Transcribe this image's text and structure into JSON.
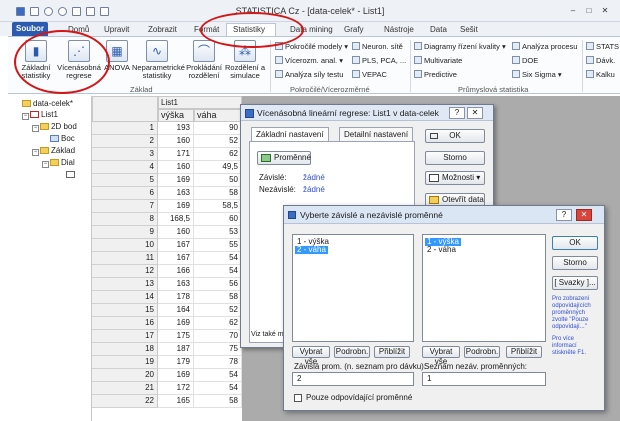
{
  "window": {
    "title": "STATISTICA Cz - [data-celek* - List1]",
    "controls": [
      "–",
      "□",
      "✕"
    ]
  },
  "ribbon": {
    "tabs": [
      "Soubor",
      "Domů",
      "Upravit",
      "Zobrazit",
      "Formát",
      "Statistiky",
      "Data mining",
      "Grafy",
      "Nástroje",
      "Data",
      "Sešit"
    ],
    "active_tab": "Statistiky",
    "big_buttons": [
      "Základní statistiky",
      "Vícenásobná regrese",
      "ANOVA",
      "Neparametrické statistiky",
      "Prokládání rozdělení",
      "Rozdělení a simulace"
    ],
    "small_buttons": [
      "Pokročilé modely",
      "Vícerozm. anal.",
      "Analýza síly testu",
      "Neuron. sítě",
      "PLS, PCA, ...",
      "VEPAC",
      "Diagramy řízení kvality",
      "Multivariate",
      "Predictive",
      "Analýza procesu",
      "DOE",
      "Six Sigma",
      "STATS",
      "Dávk.",
      "Kalku"
    ],
    "groups": [
      "Základ",
      "Pokročilé/Vícerozměrné",
      "Průmyslová statistika"
    ]
  },
  "tree": {
    "items": [
      "data-celek*",
      "List1",
      "2D bod",
      "Boc",
      "Základ",
      "Dial"
    ]
  },
  "sheet": {
    "name": "List1",
    "columns": [
      "výška",
      "váha"
    ],
    "rows": [
      {
        "n": "1",
        "vyska": "193",
        "vaha": "90"
      },
      {
        "n": "2",
        "vyska": "160",
        "vaha": "52"
      },
      {
        "n": "3",
        "vyska": "171",
        "vaha": "62"
      },
      {
        "n": "4",
        "vyska": "160",
        "vaha": "49,5"
      },
      {
        "n": "5",
        "vyska": "169",
        "vaha": "50"
      },
      {
        "n": "6",
        "vyska": "163",
        "vaha": "58"
      },
      {
        "n": "7",
        "vyska": "169",
        "vaha": "58,5"
      },
      {
        "n": "8",
        "vyska": "168,5",
        "vaha": "60"
      },
      {
        "n": "9",
        "vyska": "160",
        "vaha": "53"
      },
      {
        "n": "10",
        "vyska": "167",
        "vaha": "55"
      },
      {
        "n": "11",
        "vyska": "167",
        "vaha": "54"
      },
      {
        "n": "12",
        "vyska": "166",
        "vaha": "54"
      },
      {
        "n": "13",
        "vyska": "163",
        "vaha": "56"
      },
      {
        "n": "14",
        "vyska": "178",
        "vaha": "58"
      },
      {
        "n": "15",
        "vyska": "164",
        "vaha": "52"
      },
      {
        "n": "16",
        "vyska": "169",
        "vaha": "62"
      },
      {
        "n": "17",
        "vyska": "175",
        "vaha": "70"
      },
      {
        "n": "18",
        "vyska": "187",
        "vaha": "75"
      },
      {
        "n": "19",
        "vyska": "179",
        "vaha": "78"
      },
      {
        "n": "20",
        "vyska": "169",
        "vaha": "54"
      },
      {
        "n": "21",
        "vyska": "172",
        "vaha": "54"
      },
      {
        "n": "22",
        "vyska": "165",
        "vaha": "58"
      }
    ]
  },
  "dialog1": {
    "title": "Vícenásobná lineární regrese: List1 v data-celek",
    "help": "?",
    "close": "✕",
    "tabs": [
      "Základní nastavení",
      "Detailní nastavení"
    ],
    "variables_button": "Proměnné",
    "dependent_label": "Závislé:",
    "dependent_value": "žádné",
    "independent_label": "Nezávislé:",
    "independent_value": "žádné",
    "ok": "OK",
    "cancel": "Storno",
    "options": "Možnosti",
    "open_data": "Otevřít data",
    "footer": "Viz také m"
  },
  "dialog2": {
    "title": "Vyberte závislé a nezávislé proměnné",
    "help": "?",
    "close": "✕",
    "left_list": [
      "1 - výška",
      "2 - váha"
    ],
    "right_list": [
      "1 - výška",
      "2 - váha"
    ],
    "select_all": "Vybrat vše",
    "detail": "Podrobn.",
    "zoom": "Přiblížit",
    "dep_label": "Závislá prom. (n. seznam pro dávku):",
    "dep_value": "2",
    "indep_label": "Seznam nezáv. proměnných:",
    "indep_value": "1",
    "checkbox_label": "Pouze odpovídající proměnné",
    "ok": "OK",
    "cancel": "Storno",
    "bundles": "[ Svazky ]...",
    "hint1": "Pro zobrazení odpovídajících proměnných zvolte \"Pouze odpovídají...\"",
    "hint2": "Pro více informací stiskněte F1."
  }
}
